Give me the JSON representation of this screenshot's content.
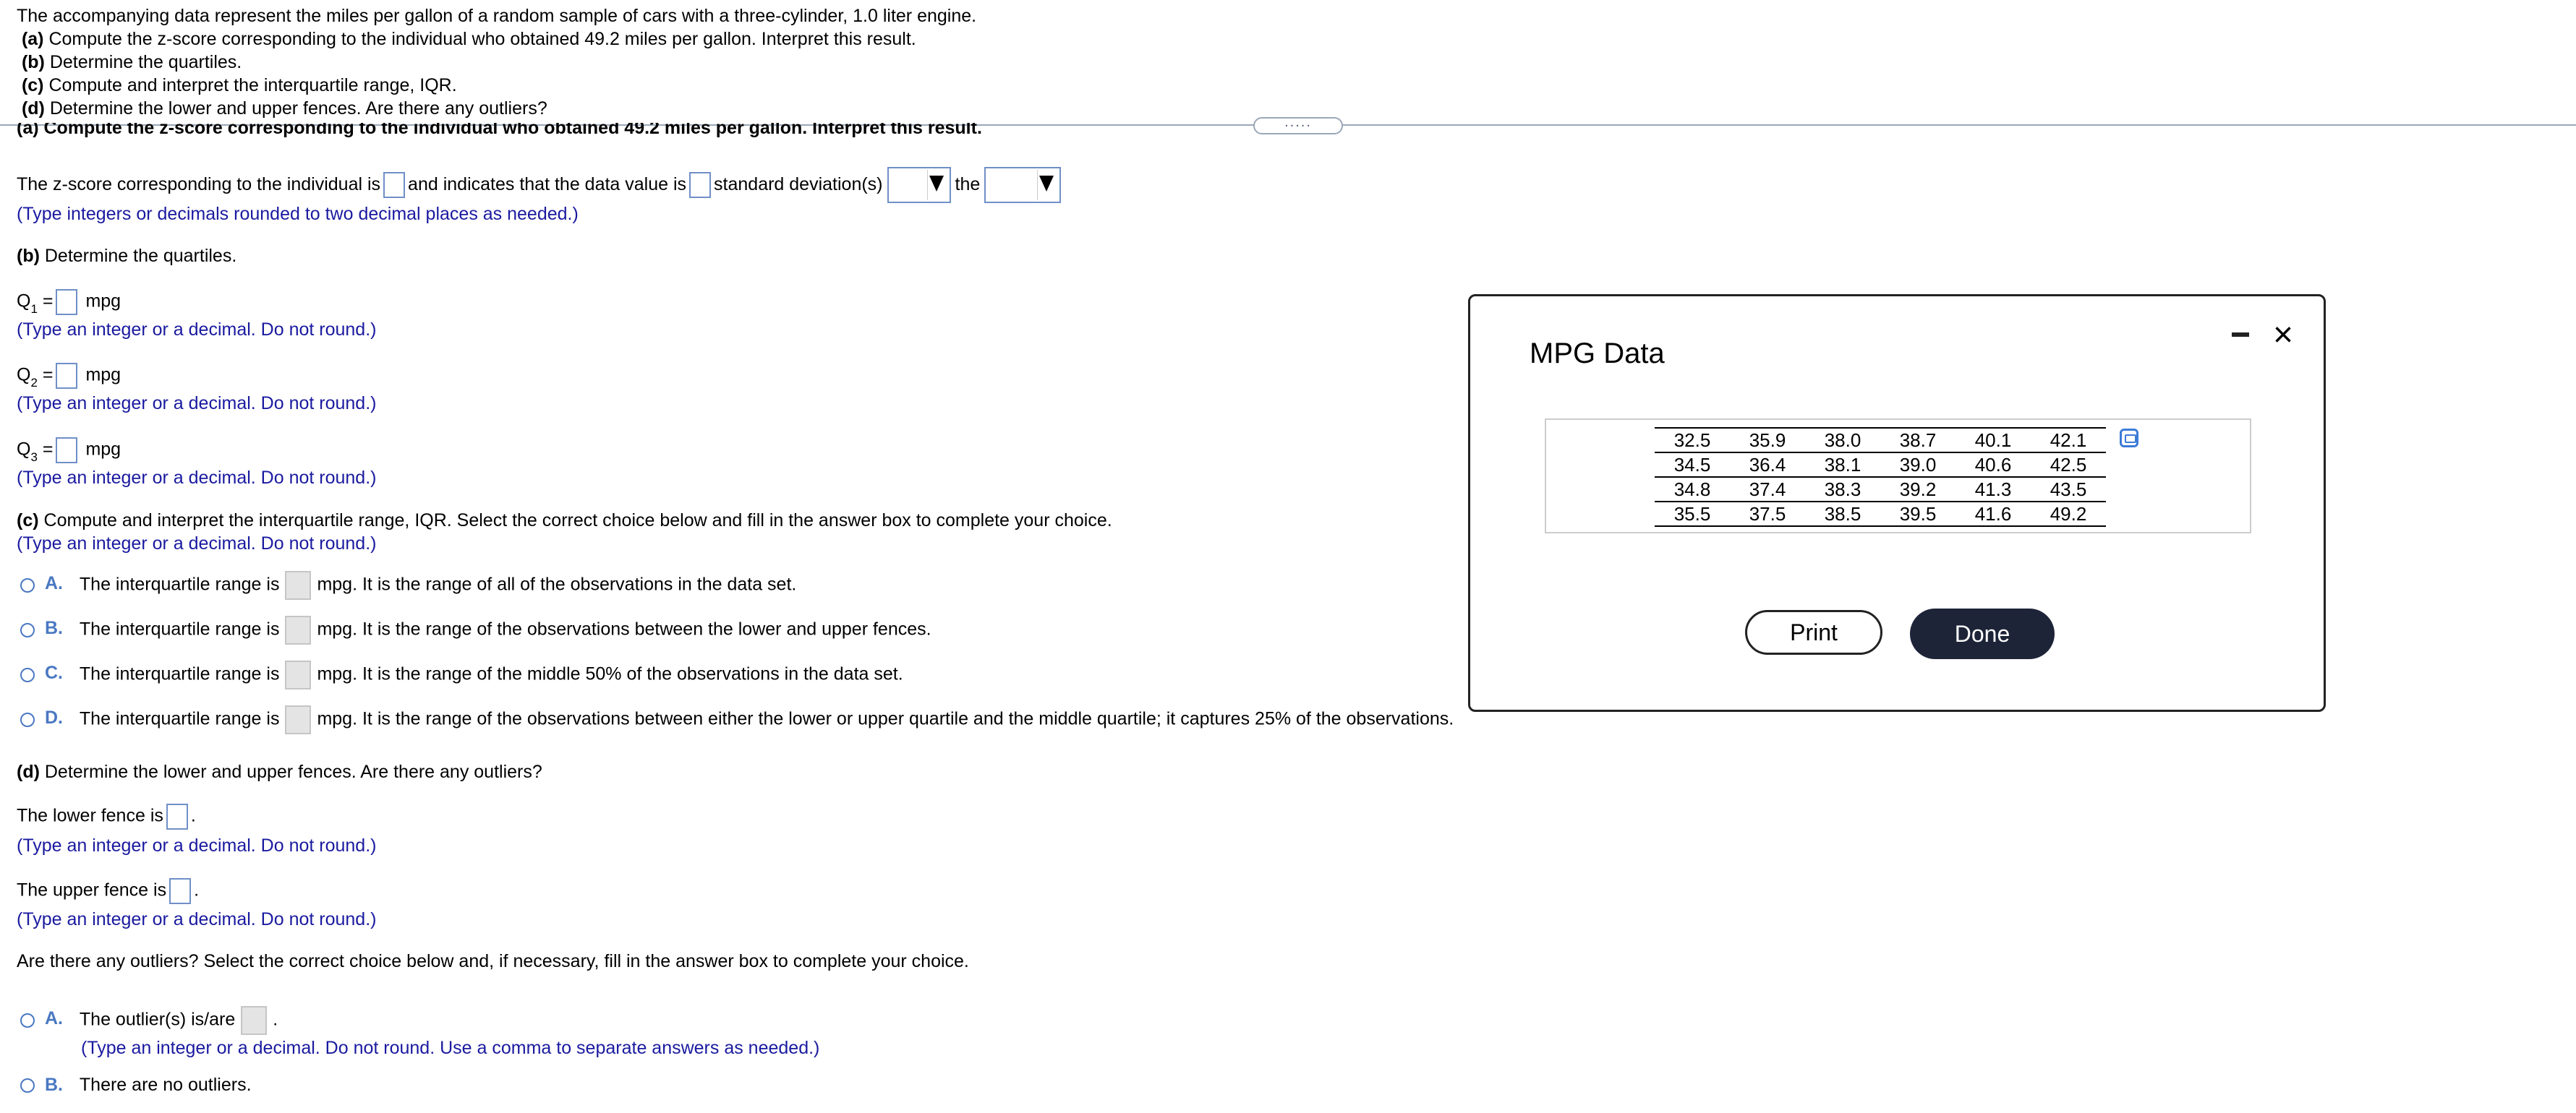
{
  "prompt": {
    "intro": "The accompanying data represent the miles per gallon of a random sample of cars with a three-cylinder, 1.0 liter engine.",
    "items": [
      {
        "letter": "(a)",
        "text": "Compute the z-score corresponding to the individual who obtained 49.2 miles per gallon. Interpret this result."
      },
      {
        "letter": "(b)",
        "text": "Determine the quartiles."
      },
      {
        "letter": "(c)",
        "text": "Compute and interpret the interquartile range, IQR."
      },
      {
        "letter": "(d)",
        "text": "Determine the lower and upper fences. Are there any outliers?"
      }
    ]
  },
  "partA": {
    "heading": "(a) Compute the z-score corresponding to the individual who obtained 49.2 miles per gallon. Interpret this result.",
    "sentence_1": "The z-score corresponding to the individual is",
    "sentence_2": "and indicates that the data value is",
    "sentence_3": "standard deviation(s)",
    "sentence_4": "the",
    "hint": "(Type integers or decimals rounded to two decimal places as needed.)"
  },
  "partB": {
    "heading_letter": "(b)",
    "heading": "Determine the quartiles.",
    "q1_label": "Q",
    "q1_sub": "1",
    "q2_label": "Q",
    "q2_sub": "2",
    "q3_label": "Q",
    "q3_sub": "3",
    "equals": "=",
    "unit": "mpg",
    "hint": "(Type an integer or a decimal. Do not round.)"
  },
  "partC": {
    "heading_letter": "(c)",
    "heading": "Compute and interpret the interquartile range, IQR. Select the correct choice below and fill in the answer box to complete your choice.",
    "hint": "(Type an integer or a decimal. Do not round.)",
    "prefix": "The interquartile range is",
    "options": [
      {
        "letter": "A.",
        "text": "mpg. It is the range of all of the observations in the data set."
      },
      {
        "letter": "B.",
        "text": "mpg. It is the range of the observations between the lower and upper fences."
      },
      {
        "letter": "C.",
        "text": "mpg. It is the range of the middle 50% of the observations in the data set."
      },
      {
        "letter": "D.",
        "text": "mpg. It is the range of the observations between either the lower or upper quartile and the middle quartile; it captures 25% of the observations."
      }
    ]
  },
  "partD": {
    "heading_letter": "(d)",
    "heading": "Determine the lower and upper fences. Are there any outliers?",
    "lower_label": "The lower fence is",
    "upper_label": "The upper fence is",
    "period": ".",
    "hint": "(Type an integer or a decimal. Do not round.)",
    "question": "Are there any outliers? Select the correct choice below and, if necessary, fill in the answer box to complete your choice.",
    "optionA_letter": "A.",
    "optionA_text": "The outlier(s) is/are",
    "optionA_hint": "(Type an integer or a decimal. Do not round. Use a comma to separate answers as needed.)",
    "optionB_letter": "B.",
    "optionB_text": "There are no outliers."
  },
  "divider_grip": ".....",
  "modal": {
    "title": "MPG Data",
    "minimize_icon": "minimize-icon",
    "close_icon": "close-icon",
    "close_glyph": "×",
    "print_label": "Print",
    "done_label": "Done",
    "table": [
      [
        "32.5",
        "35.9",
        "38.0",
        "38.7",
        "40.1",
        "42.1"
      ],
      [
        "34.5",
        "36.4",
        "38.1",
        "39.0",
        "40.6",
        "42.5"
      ],
      [
        "34.8",
        "37.4",
        "38.3",
        "39.2",
        "41.3",
        "43.5"
      ],
      [
        "35.5",
        "37.5",
        "38.5",
        "39.5",
        "41.6",
        "49.2"
      ]
    ]
  },
  "colors": {
    "hint_text": "#1a1aa0",
    "input_border": "#6f8fc7",
    "done_button": "#1d2438",
    "radio": "#4a78c2"
  }
}
